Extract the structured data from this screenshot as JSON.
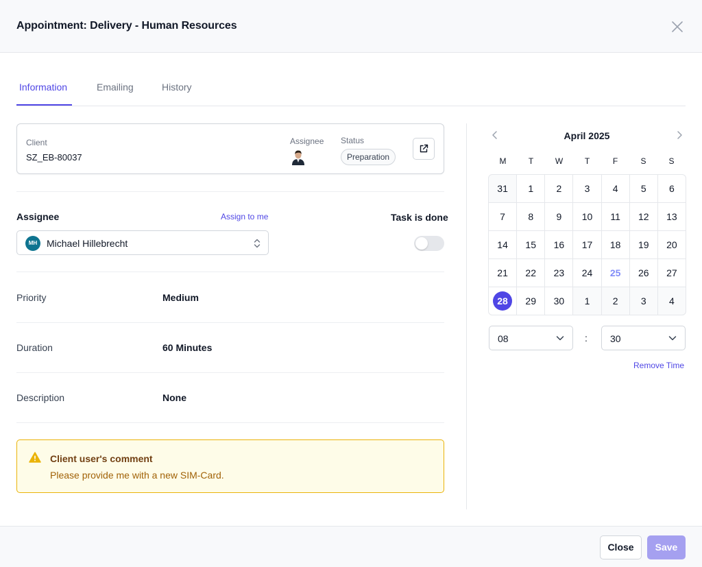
{
  "header": {
    "title": "Appointment: Delivery - Human Resources"
  },
  "tabs": [
    {
      "label": "Information",
      "active": true
    },
    {
      "label": "Emailing",
      "active": false
    },
    {
      "label": "History",
      "active": false
    }
  ],
  "client_card": {
    "client_label": "Client",
    "client_value": "SZ_EB-80037",
    "assignee_label": "Assignee",
    "status_label": "Status",
    "status_value": "Preparation"
  },
  "assignee": {
    "label": "Assignee",
    "assign_to_me": "Assign to me",
    "initials": "MH",
    "name": "Michael Hillebrecht"
  },
  "task_done": {
    "label": "Task is done",
    "checked": false
  },
  "details": {
    "priority_label": "Priority",
    "priority_value": "Medium",
    "duration_label": "Duration",
    "duration_value": "60 Minutes",
    "description_label": "Description",
    "description_value": "None"
  },
  "comment": {
    "title": "Client user's comment",
    "text": "Please provide me with a new SIM-Card."
  },
  "calendar": {
    "month_title": "April 2025",
    "weekdays": [
      "M",
      "T",
      "W",
      "T",
      "F",
      "S",
      "S"
    ],
    "days": [
      {
        "d": "31",
        "other": true
      },
      {
        "d": "1"
      },
      {
        "d": "2"
      },
      {
        "d": "3"
      },
      {
        "d": "4"
      },
      {
        "d": "5"
      },
      {
        "d": "6"
      },
      {
        "d": "7"
      },
      {
        "d": "8"
      },
      {
        "d": "9"
      },
      {
        "d": "10"
      },
      {
        "d": "11"
      },
      {
        "d": "12"
      },
      {
        "d": "13"
      },
      {
        "d": "14"
      },
      {
        "d": "15"
      },
      {
        "d": "16"
      },
      {
        "d": "17"
      },
      {
        "d": "18"
      },
      {
        "d": "19"
      },
      {
        "d": "20"
      },
      {
        "d": "21"
      },
      {
        "d": "22"
      },
      {
        "d": "23"
      },
      {
        "d": "24"
      },
      {
        "d": "25",
        "today": true
      },
      {
        "d": "26"
      },
      {
        "d": "27"
      },
      {
        "d": "28",
        "selected": true
      },
      {
        "d": "29"
      },
      {
        "d": "30"
      },
      {
        "d": "1",
        "other": true
      },
      {
        "d": "2",
        "other": true
      },
      {
        "d": "3",
        "other": true
      },
      {
        "d": "4",
        "other": true
      }
    ],
    "hour": "08",
    "minute": "30",
    "separator": ":",
    "remove_time": "Remove Time"
  },
  "footer": {
    "close_label": "Close",
    "save_label": "Save"
  },
  "colors": {
    "accent": "#4f46e5",
    "save_disabled": "#a5a0f0",
    "warning_border": "#eab308"
  }
}
